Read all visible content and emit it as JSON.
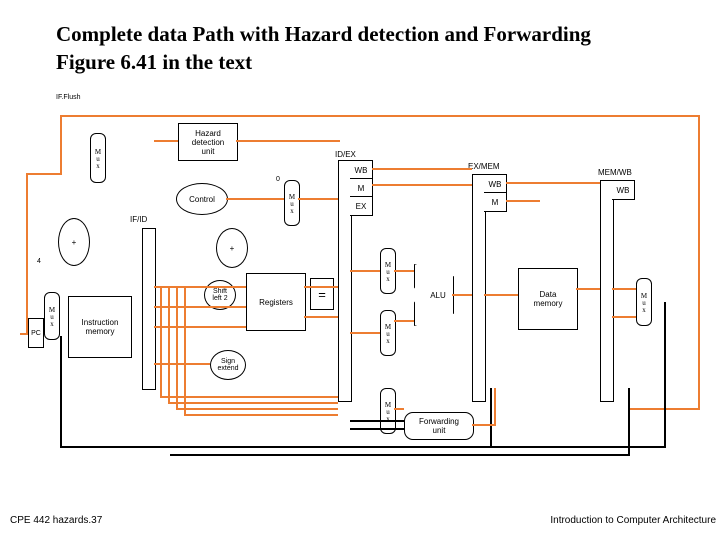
{
  "title_l1": "Complete data Path with Hazard detection and Forwarding",
  "title_l2": "Figure 6.41 in the text",
  "footer_left": "CPE 442  hazards.37",
  "footer_right": "Introduction to Computer Architecture",
  "ifflush": "IF.Flush",
  "hazard": "Hazard\ndetection\nunit",
  "control": "Control",
  "imem": "Instruction\nmemory",
  "regfile": "Registers",
  "signext": "Sign\nextend",
  "shl2": "Shift\nleft 2",
  "alu": "ALU",
  "eq": "=",
  "dmem": "Data\nmemory",
  "fwd": "Forwarding\nunit",
  "pc": "PC",
  "plus": "+",
  "four": "4",
  "zero": "0",
  "mux": "Mux",
  "ifid": "IF/ID",
  "idex": "ID/EX",
  "exmem": "EX/MEM",
  "memwb": "MEM/WB",
  "wb": "WB",
  "m": "M",
  "ex": "EX"
}
